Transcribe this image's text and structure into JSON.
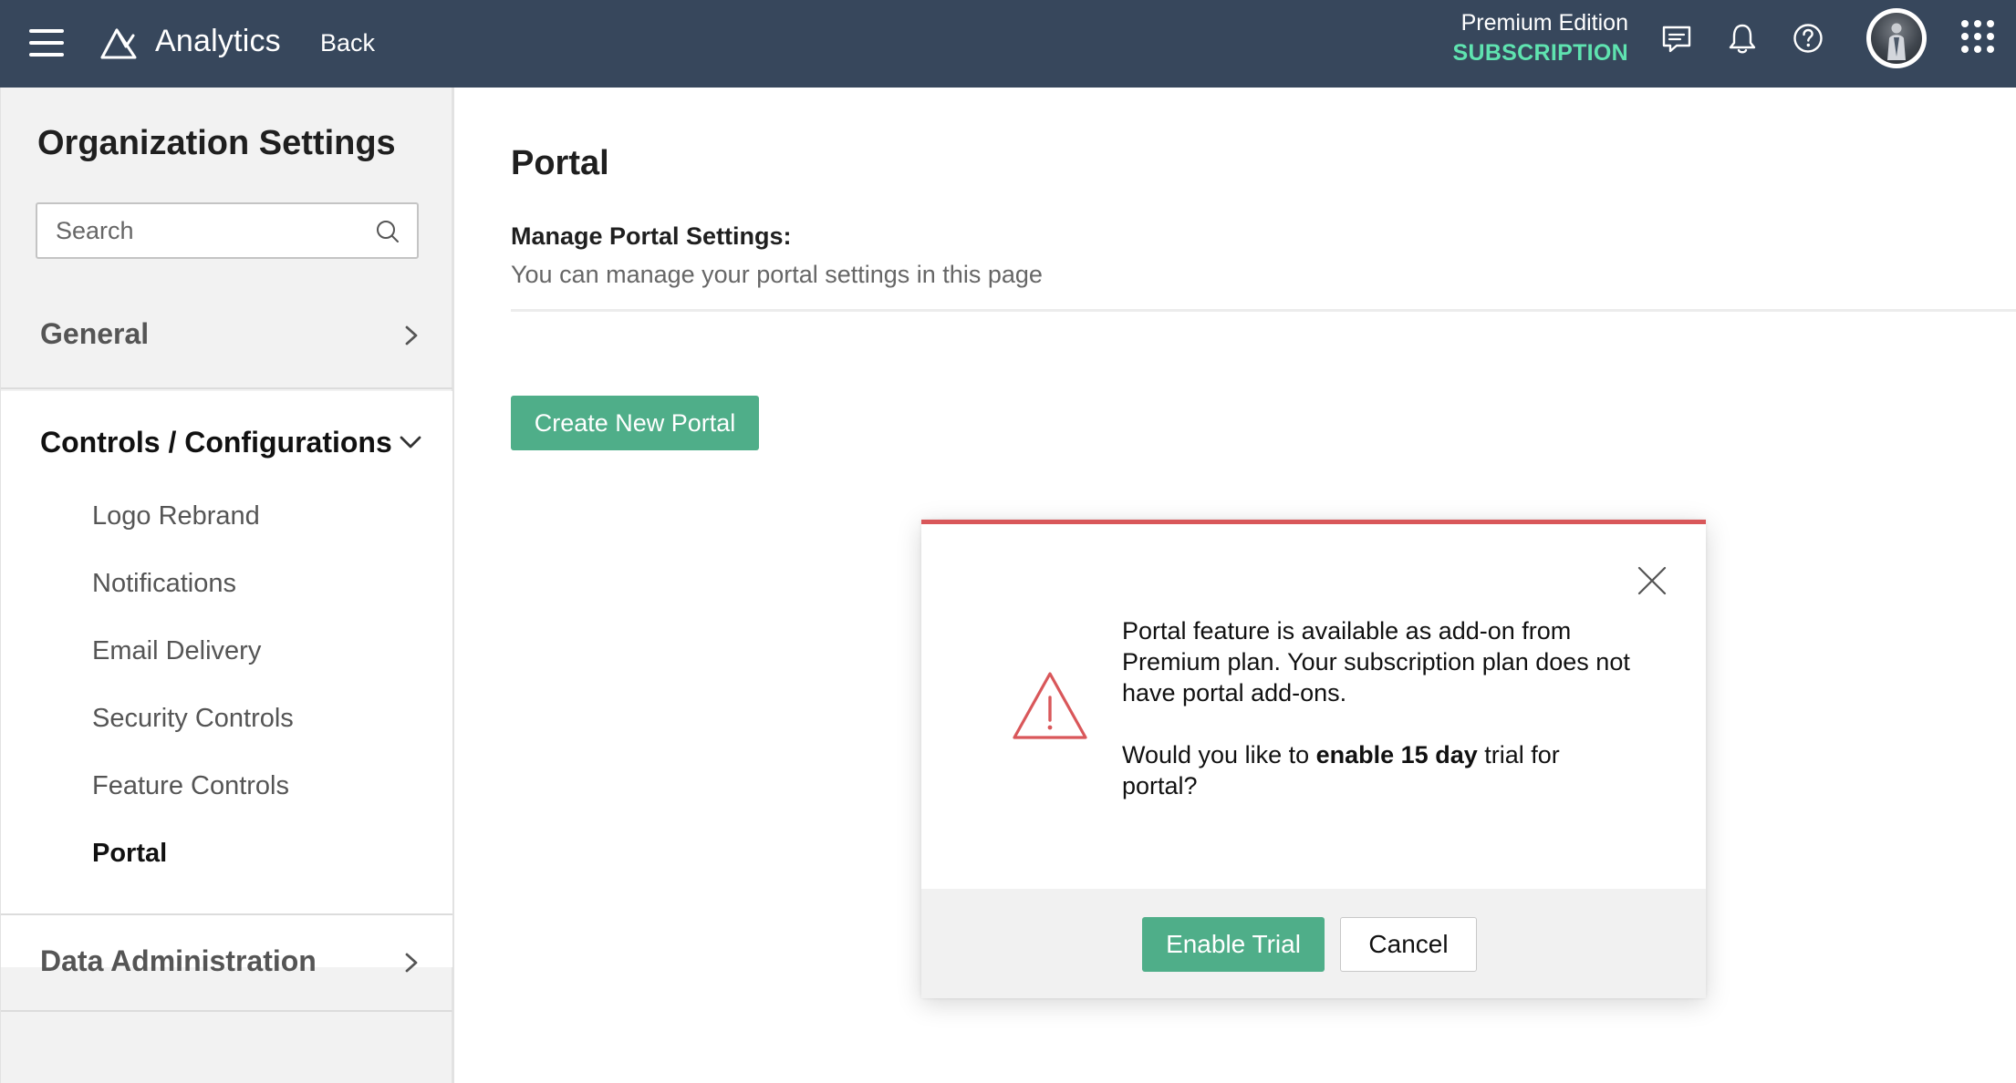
{
  "topbar": {
    "app_name": "Analytics",
    "back_label": "Back",
    "edition_name": "Premium Edition",
    "subscription_label": "SUBSCRIPTION",
    "icons": [
      "menu-icon",
      "analytics-logo-icon",
      "feedback-icon",
      "bell-icon",
      "help-icon",
      "avatar",
      "apps-grid-icon"
    ],
    "colors": {
      "bar": "#37475c",
      "subscription": "#5fe3b0"
    }
  },
  "sidebar": {
    "title": "Organization Settings",
    "search_placeholder": "Search",
    "sections": [
      {
        "label": "General",
        "expanded": false
      },
      {
        "label": "Controls / Configurations",
        "expanded": true,
        "items": [
          {
            "label": "Logo Rebrand",
            "active": false
          },
          {
            "label": "Notifications",
            "active": false
          },
          {
            "label": "Email Delivery",
            "active": false
          },
          {
            "label": "Security Controls",
            "active": false
          },
          {
            "label": "Feature Controls",
            "active": false
          },
          {
            "label": "Portal",
            "active": true
          }
        ]
      },
      {
        "label": "Data Administration",
        "expanded": false
      }
    ]
  },
  "main": {
    "title": "Portal",
    "manage_title": "Manage Portal Settings:",
    "manage_desc": "You can manage your portal settings in this page",
    "create_button": "Create New Portal",
    "accent_color": "#4fae89"
  },
  "modal": {
    "message_line1": "Portal feature is available as add-on from Premium plan. Your subscription plan does not have portal add-ons.",
    "question_prefix": "Would you like to ",
    "question_bold": "enable 15 day",
    "question_suffix": " trial for portal?",
    "enable_button": "Enable Trial",
    "cancel_button": "Cancel",
    "alert_color": "#d9575a"
  }
}
